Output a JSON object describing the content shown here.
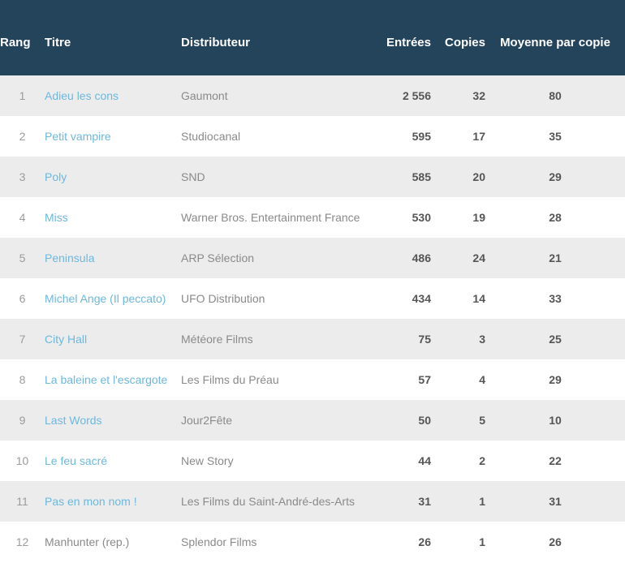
{
  "table": {
    "columns": [
      {
        "key": "rang",
        "label": "Rang"
      },
      {
        "key": "titre",
        "label": "Titre"
      },
      {
        "key": "distrib",
        "label": "Distributeur"
      },
      {
        "key": "entrees",
        "label": "Entrées"
      },
      {
        "key": "copies",
        "label": "Copies"
      },
      {
        "key": "moyenne",
        "label": "Moyenne par copie"
      }
    ],
    "header": {
      "rang": "Rang",
      "titre": "Titre",
      "distributeur": "Distributeur",
      "entrees": "Entrées",
      "copies": "Copies",
      "moyenne": "Moyenne par copie"
    },
    "colors": {
      "header_background": "#24445c",
      "header_text": "#ffffff",
      "row_odd_background": "#ececec",
      "row_even_background": "#ffffff",
      "link": "#6cb8dd",
      "muted_text": "#8a8a8a",
      "number_text": "#555555",
      "rank_text": "#9b9b9b"
    },
    "rows": [
      {
        "rang": "1",
        "titre": "Adieu les cons",
        "titre_is_link": true,
        "distributeur": "Gaumont",
        "entrees": "2 556",
        "copies": "32",
        "moyenne": "80"
      },
      {
        "rang": "2",
        "titre": "Petit vampire",
        "titre_is_link": true,
        "distributeur": "Studiocanal",
        "entrees": "595",
        "copies": "17",
        "moyenne": "35"
      },
      {
        "rang": "3",
        "titre": "Poly",
        "titre_is_link": true,
        "distributeur": "SND",
        "entrees": "585",
        "copies": "20",
        "moyenne": "29"
      },
      {
        "rang": "4",
        "titre": "Miss",
        "titre_is_link": true,
        "distributeur": "Warner Bros. Entertainment France",
        "entrees": "530",
        "copies": "19",
        "moyenne": "28"
      },
      {
        "rang": "5",
        "titre": "Peninsula",
        "titre_is_link": true,
        "distributeur": "ARP Sélection",
        "entrees": "486",
        "copies": "24",
        "moyenne": "21"
      },
      {
        "rang": "6",
        "titre": "Michel Ange (Il peccato)",
        "titre_is_link": true,
        "distributeur": "UFO Distribution",
        "entrees": "434",
        "copies": "14",
        "moyenne": "33"
      },
      {
        "rang": "7",
        "titre": "City Hall",
        "titre_is_link": true,
        "distributeur": "Météore Films",
        "entrees": "75",
        "copies": "3",
        "moyenne": "25"
      },
      {
        "rang": "8",
        "titre": "La baleine et l'escargote",
        "titre_is_link": true,
        "distributeur": "Les Films du Préau",
        "entrees": "57",
        "copies": "4",
        "moyenne": "29"
      },
      {
        "rang": "9",
        "titre": "Last Words",
        "titre_is_link": true,
        "distributeur": "Jour2Fête",
        "entrees": "50",
        "copies": "5",
        "moyenne": "10"
      },
      {
        "rang": "10",
        "titre": "Le feu sacré",
        "titre_is_link": true,
        "distributeur": "New Story",
        "entrees": "44",
        "copies": "2",
        "moyenne": "22"
      },
      {
        "rang": "11",
        "titre": "Pas en mon nom !",
        "titre_is_link": true,
        "distributeur": "Les Films du Saint-André-des-Arts",
        "entrees": "31",
        "copies": "1",
        "moyenne": "31"
      },
      {
        "rang": "12",
        "titre": "Manhunter (rep.)",
        "titre_is_link": false,
        "distributeur": "Splendor Films",
        "entrees": "26",
        "copies": "1",
        "moyenne": "26"
      }
    ]
  }
}
